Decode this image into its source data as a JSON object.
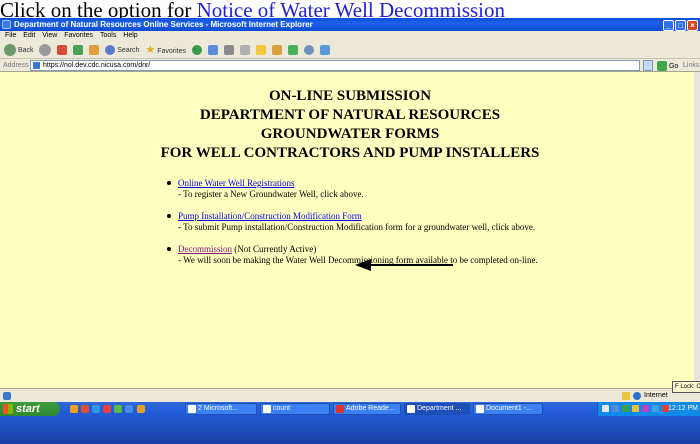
{
  "heading": {
    "prefix": "Click on the option for ",
    "link": "Notice of Water Well Decommission"
  },
  "window": {
    "title": "Department of Natural Resources Online Services - Microsoft Internet Explorer"
  },
  "menubar": [
    "File",
    "Edit",
    "View",
    "Favorites",
    "Tools",
    "Help"
  ],
  "toolbar": {
    "back": "Back",
    "search": "Search",
    "favorites": "Favorites"
  },
  "addressbar": {
    "label": "Address",
    "url": "https://nol.dev.cdc.nicusa.com/dnr/",
    "go": "Go",
    "links": "Links"
  },
  "page": {
    "headings": [
      "ON-LINE SUBMISSION",
      "DEPARTMENT OF NATURAL RESOURCES",
      "GROUNDWATER FORMS",
      "FOR WELL CONTRACTORS AND PUMP INSTALLERS"
    ],
    "items": [
      {
        "link": "Online Water Well Registrations",
        "note": "",
        "description": "- To register a New Groundwater Well, click above."
      },
      {
        "link": "Pump Installation/Construction Modification Form",
        "note": "",
        "description": "- To submit Pump installation/Construction Modification form for a groundwater well, click above."
      },
      {
        "link": "Decommission",
        "note": " (Not Currently Active)",
        "description": "- We will soon be making the Water Well Decommissioning form available to be completed on-line."
      }
    ]
  },
  "statusbar": {
    "zone": "Internet",
    "flock": "F Lock: OFF"
  },
  "taskbar": {
    "start": "start",
    "tasks": [
      "2 Microsoft...",
      "count",
      "Adobe Reade...",
      "Department ...",
      "Document1 -..."
    ],
    "clock": "12:12 PM"
  },
  "colors": {
    "page_background": "#ffffc0",
    "link": "#0000ee",
    "visited_link": "#80187c",
    "titlebar": "#0a4fd8"
  }
}
